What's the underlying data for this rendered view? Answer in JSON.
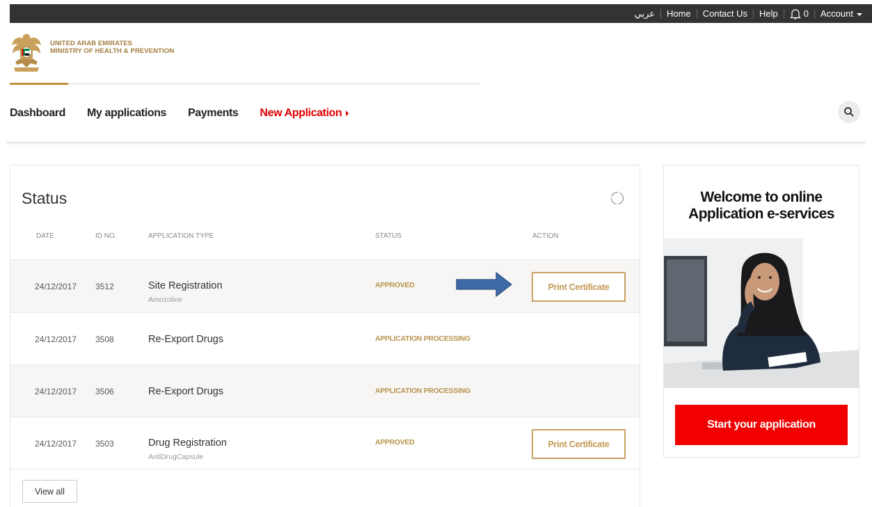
{
  "topbar": {
    "language": "عربي",
    "home": "Home",
    "contact": "Contact Us",
    "help": "Help",
    "notification_count": "0",
    "account": "Account"
  },
  "logo": {
    "line1": "UNITED ARAB EMIRATES",
    "line2": "MINISTRY OF HEALTH & PREVENTION"
  },
  "nav": {
    "items": [
      {
        "label": "Dashboard"
      },
      {
        "label": "My applications"
      },
      {
        "label": "Payments"
      },
      {
        "label": "New Application"
      }
    ]
  },
  "status": {
    "title": "Status",
    "columns": [
      "DATE",
      "ID NO.",
      "APPLICATION TYPE",
      "STATUS",
      "ACTION"
    ],
    "rows": [
      {
        "date": "24/12/2017",
        "id": "3512",
        "type": "Site Registration",
        "sub": "Amozoline",
        "status": "APPROVED",
        "action": "Print Certificate"
      },
      {
        "date": "24/12/2017",
        "id": "3508",
        "type": "Re-Export Drugs",
        "sub": "",
        "status": "APPLICATION PROCESSING",
        "action": ""
      },
      {
        "date": "24/12/2017",
        "id": "3506",
        "type": "Re-Export Drugs",
        "sub": "",
        "status": "APPLICATION PROCESSING",
        "action": ""
      },
      {
        "date": "24/12/2017",
        "id": "3503",
        "type": "Drug Registration",
        "sub": "AntiDrugCapsule",
        "status": "APPROVED",
        "action": "Print Certificate"
      }
    ],
    "view_all": "View all"
  },
  "welcome": {
    "title_line1": "Welcome to online",
    "title_line2": "Application e-services",
    "start_button": "Start your application"
  },
  "colors": {
    "topbar": "#333333",
    "accent_red": "#f20000",
    "gold": "#c3903f",
    "status_gold": "#b99451",
    "arrow_blue": "#3f6aa8"
  }
}
